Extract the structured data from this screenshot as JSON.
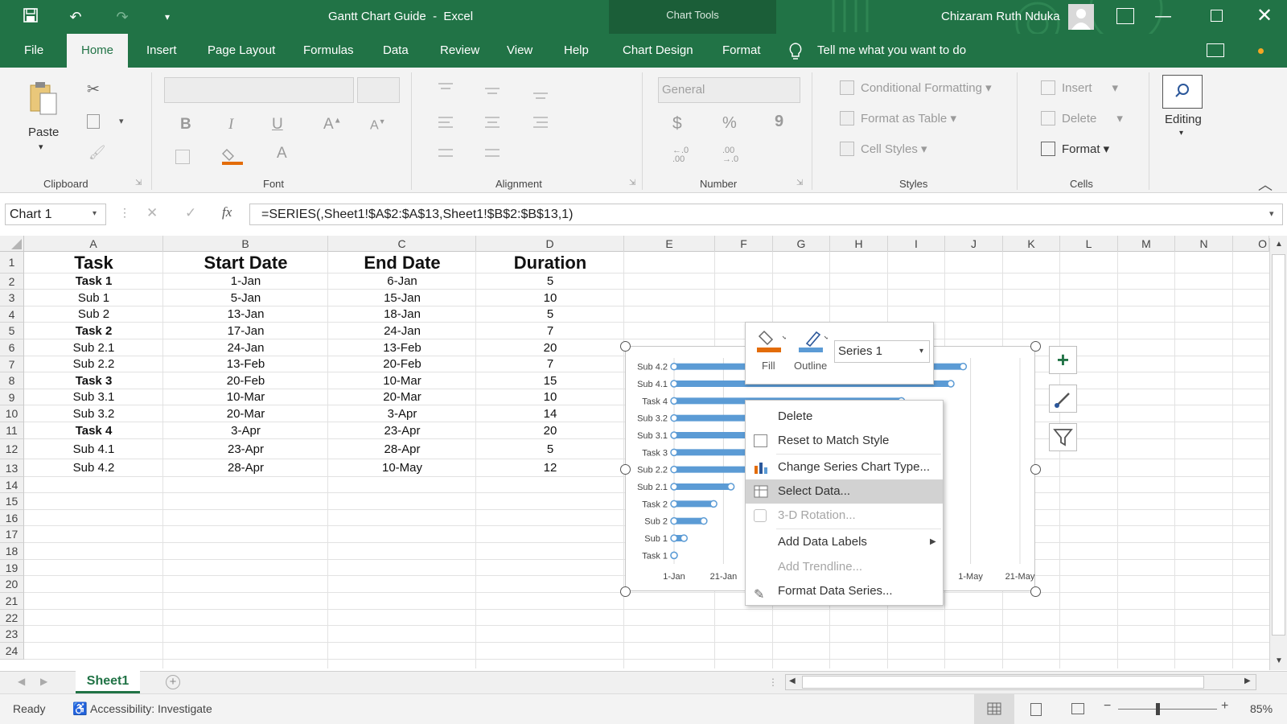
{
  "window": {
    "doc_title": "Gantt Chart Guide",
    "app": "Excel",
    "title_sep": "-",
    "chart_tools_label": "Chart Tools",
    "user_name": "Chizaram Ruth Nduka"
  },
  "tabs": [
    {
      "label": "File"
    },
    {
      "label": "Home"
    },
    {
      "label": "Insert"
    },
    {
      "label": "Page Layout"
    },
    {
      "label": "Formulas"
    },
    {
      "label": "Data"
    },
    {
      "label": "Review"
    },
    {
      "label": "View"
    },
    {
      "label": "Help"
    },
    {
      "label": "Chart Design"
    },
    {
      "label": "Format"
    }
  ],
  "tell_me": "Tell me what you want to do",
  "ribbon": {
    "clipboard": {
      "paste": "Paste",
      "label": "Clipboard"
    },
    "font": {
      "label": "Font",
      "bold": "B",
      "italic": "I",
      "underline": "U",
      "font_color": "A"
    },
    "alignment": {
      "label": "Alignment"
    },
    "number": {
      "label": "Number",
      "format": "General",
      "currency": "$",
      "percent": "%",
      "comma": "9",
      "inc_decimal": "←.0\n.00",
      "dec_decimal": ".00\n→.0"
    },
    "styles": {
      "label": "Styles",
      "conditional": "Conditional Formatting",
      "table": "Format as Table",
      "cell_styles": "Cell Styles"
    },
    "cells": {
      "label": "Cells",
      "insert": "Insert",
      "delete": "Delete",
      "format": "Format"
    },
    "editing": {
      "label": "Editing"
    }
  },
  "formula_bar": {
    "name_box": "Chart 1",
    "fx": "fx",
    "formula": "=SERIES(,Sheet1!$A$2:$A$13,Sheet1!$B$2:$B$13,1)"
  },
  "columns": [
    "A",
    "B",
    "C",
    "D",
    "E",
    "F",
    "G",
    "H",
    "I",
    "J",
    "K",
    "L",
    "M",
    "N",
    "O"
  ],
  "rows": [
    "1",
    "2",
    "3",
    "4",
    "5",
    "6",
    "7",
    "8",
    "9",
    "10",
    "11",
    "12",
    "13",
    "14",
    "15",
    "16",
    "17",
    "18",
    "19",
    "20",
    "21",
    "22",
    "23",
    "24"
  ],
  "sheet": {
    "headers": [
      "Task",
      "Start Date",
      "End Date",
      "Duration"
    ],
    "data": [
      [
        "Task 1",
        "1-Jan",
        "6-Jan",
        "5"
      ],
      [
        "Sub 1",
        "5-Jan",
        "15-Jan",
        "10"
      ],
      [
        "Sub 2",
        "13-Jan",
        "18-Jan",
        "5"
      ],
      [
        "Task 2",
        "17-Jan",
        "24-Jan",
        "7"
      ],
      [
        "Sub 2.1",
        "24-Jan",
        "13-Feb",
        "20"
      ],
      [
        "Sub 2.2",
        "13-Feb",
        "20-Feb",
        "7"
      ],
      [
        "Task 3",
        "20-Feb",
        "10-Mar",
        "15"
      ],
      [
        "Sub 3.1",
        "10-Mar",
        "20-Mar",
        "10"
      ],
      [
        "Sub 3.2",
        "20-Mar",
        "3-Apr",
        "14"
      ],
      [
        "Task 4",
        "3-Apr",
        "23-Apr",
        "20"
      ],
      [
        "Sub 4.1",
        "23-Apr",
        "28-Apr",
        "5"
      ],
      [
        "Sub 4.2",
        "28-Apr",
        "10-May",
        "12"
      ]
    ]
  },
  "chart_data": {
    "type": "bar",
    "orientation": "horizontal",
    "categories": [
      "Task 1",
      "Sub 1",
      "Sub 2",
      "Task 2",
      "Sub 2.1",
      "Sub 2.2",
      "Task 3",
      "Sub 3.1",
      "Sub 3.2",
      "Task 4",
      "Sub 4.1",
      "Sub 4.2"
    ],
    "series": [
      {
        "values_days": [
          0,
          4,
          12,
          16,
          23,
          43,
          50,
          68,
          78,
          92,
          112,
          117
        ]
      }
    ],
    "x_tick_labels": [
      "1-Jan",
      "21-Jan",
      "1-May",
      "21-May"
    ],
    "xlim_days": [
      0,
      140
    ],
    "grid": "vertical",
    "bar_color": "#5b9bd5"
  },
  "mini_toolbar": {
    "fill": "Fill",
    "outline": "Outline",
    "series": "Series 1"
  },
  "context_menu": [
    {
      "label": "Delete",
      "disabled": false
    },
    {
      "label": "Reset to Match Style",
      "disabled": false
    },
    {
      "label": "Change Series Chart Type...",
      "disabled": false
    },
    {
      "label": "Select Data...",
      "disabled": false,
      "highlighted": true
    },
    {
      "label": "3-D Rotation...",
      "disabled": true
    },
    {
      "label": "Add Data Labels",
      "disabled": false
    },
    {
      "label": "Add Trendline...",
      "disabled": true
    },
    {
      "label": "Format Data Series...",
      "disabled": false
    }
  ],
  "sheet_tabs": [
    "Sheet1"
  ],
  "status": {
    "ready": "Ready",
    "accessibility": "Accessibility: Investigate",
    "zoom": "85%"
  },
  "colors": {
    "excel_green": "#217346",
    "bar": "#5b9bd5",
    "orange": "#e36c09"
  }
}
